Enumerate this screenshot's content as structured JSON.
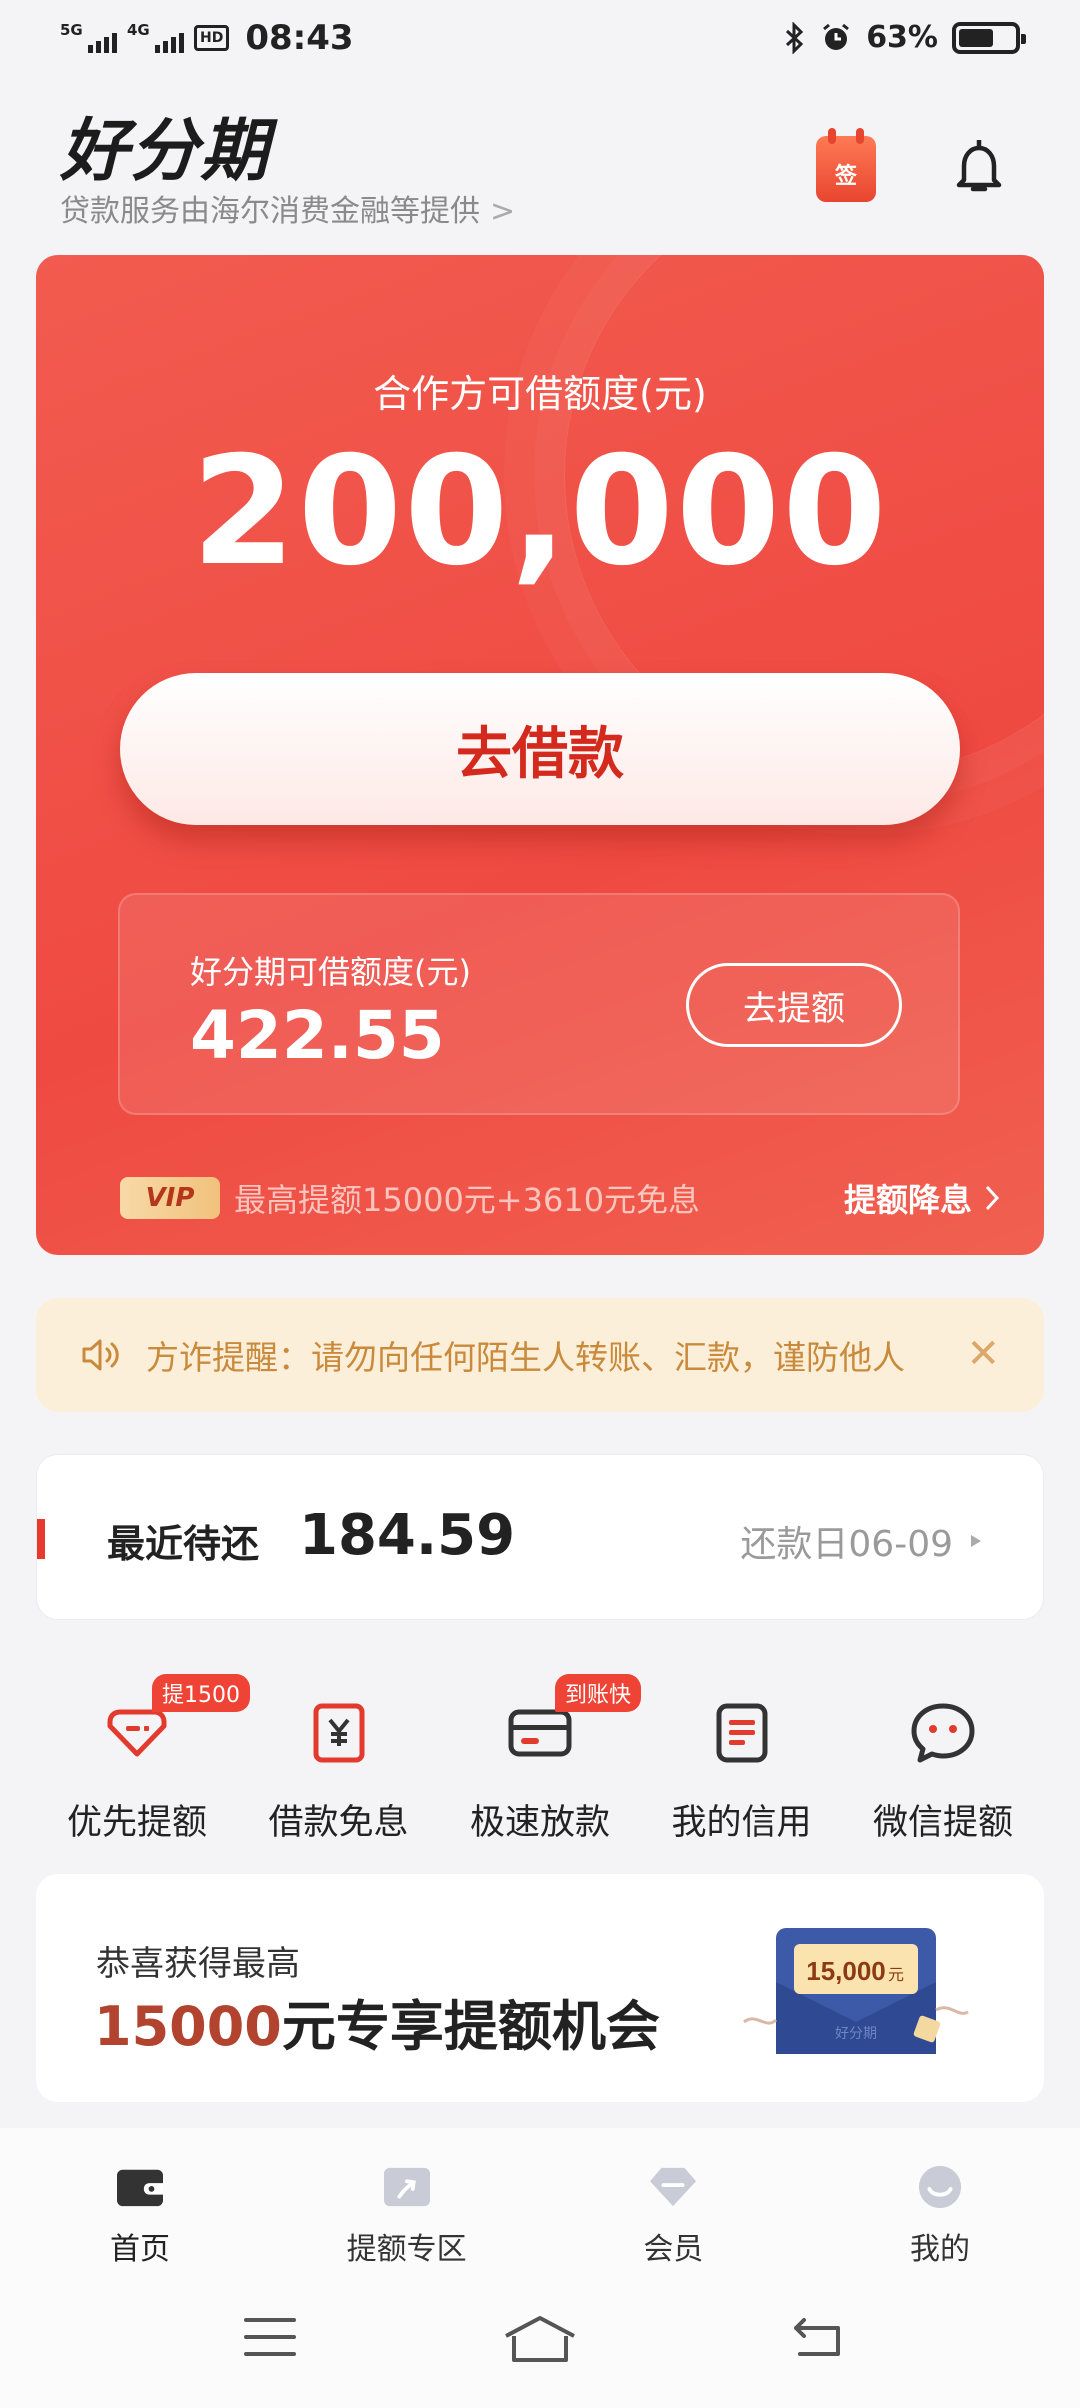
{
  "status_bar": {
    "network1": "5G",
    "network2": "4G",
    "hd": "HD",
    "time": "08:43",
    "battery_pct": "63%",
    "battery_level": 0.63
  },
  "header": {
    "logo": "好分期",
    "subtitle": "贷款服务由海尔消费金融等提供",
    "sign_icon_text": "签"
  },
  "card": {
    "partner_label": "合作方可借额度(元)",
    "partner_amount": "200,000",
    "borrow_button": "去借款",
    "own_label": "好分期可借额度(元)",
    "own_amount": "422.55",
    "raise_button": "去提额",
    "vip_badge": "VIP",
    "vip_text": "最高提额15000元+3610元免息",
    "vip_link": "提额降息"
  },
  "notice": {
    "text": "方诈提醒：请勿向任何陌生人转账、汇款，谨防他人"
  },
  "repay": {
    "label": "最近待还",
    "amount": "184.59",
    "date": "还款日06-09"
  },
  "actions": [
    {
      "label": "优先提额",
      "tag": "提1500",
      "icon": "tag-icon"
    },
    {
      "label": "借款免息",
      "tag": "",
      "icon": "yen-icon"
    },
    {
      "label": "极速放款",
      "tag": "到账快",
      "icon": "card-icon"
    },
    {
      "label": "我的信用",
      "tag": "",
      "icon": "document-icon"
    },
    {
      "label": "微信提额",
      "tag": "",
      "icon": "chat-icon"
    }
  ],
  "promo": {
    "line1": "恭喜获得最高",
    "amount": "15000",
    "line2_rest": "元专享提额机会",
    "envelope_amount": "15,000",
    "envelope_unit": "元",
    "envelope_brand": "好分期"
  },
  "bottom_nav": [
    {
      "label": "首页",
      "icon": "wallet-icon"
    },
    {
      "label": "提额专区",
      "icon": "boost-icon"
    },
    {
      "label": "会员",
      "icon": "diamond-icon"
    },
    {
      "label": "我的",
      "icon": "profile-icon"
    }
  ],
  "colors": {
    "brand_red": "#ef4a42",
    "notice_bg": "#fcefd9",
    "notice_text": "#c98a3c"
  }
}
